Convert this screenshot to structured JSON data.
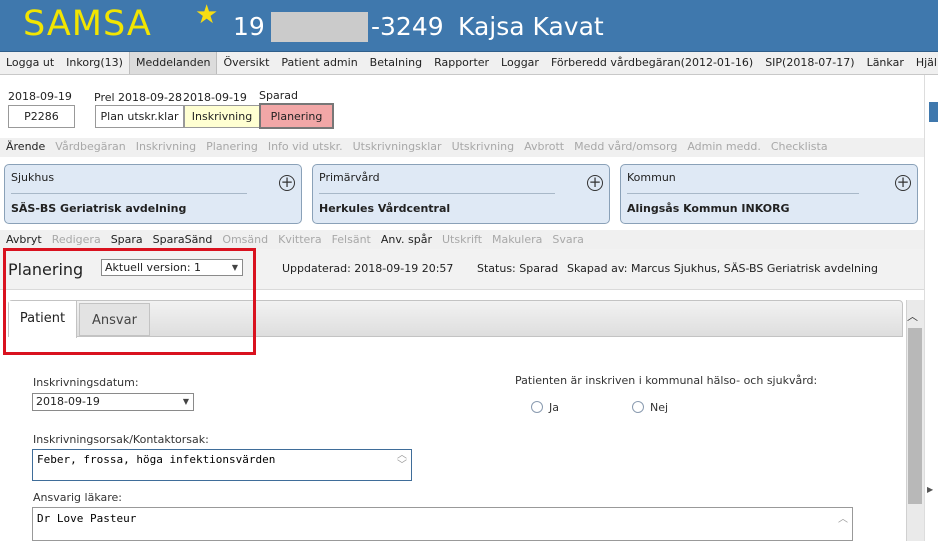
{
  "header": {
    "logo": "SAMSA",
    "patient_prefix": "19",
    "patient_suffix": "-3249",
    "patient_name": "Kajsa Kavat"
  },
  "menu": [
    "Logga ut",
    "Inkorg(13)",
    "Meddelanden",
    "Översikt",
    "Patient admin",
    "Betalning",
    "Rapporter",
    "Loggar",
    "Förberedd vårdbegäran(2012-01-16)",
    "SIP(2018-07-17)",
    "Länkar",
    "Hjälp"
  ],
  "menu_active": "Meddelanden",
  "info": {
    "date1": "2018-09-19",
    "id": "P2286",
    "prel_label": "Prel 2018-09-28",
    "date2": "2018-09-19",
    "sparad": "Sparad",
    "btn_plan": "Plan utskr.klar",
    "btn_inskrivning": "Inskrivning",
    "btn_planering": "Planering"
  },
  "steps": [
    {
      "label": "Ärende",
      "on": true
    },
    {
      "label": "Vårdbegäran",
      "on": false
    },
    {
      "label": "Inskrivning",
      "on": false
    },
    {
      "label": "Planering",
      "on": false
    },
    {
      "label": "Info vid utskr.",
      "on": false
    },
    {
      "label": "Utskrivningsklar",
      "on": false
    },
    {
      "label": "Utskrivning",
      "on": false
    },
    {
      "label": "Avbrott",
      "on": false
    },
    {
      "label": "Medd vård/omsorg",
      "on": false
    },
    {
      "label": "Admin medd.",
      "on": false
    },
    {
      "label": "Checklista",
      "on": false
    }
  ],
  "cards": [
    {
      "title": "Sjukhus",
      "value": "SÄS-BS Geriatrisk avdelning"
    },
    {
      "title": "Primärvård",
      "value": "Herkules Vårdcentral"
    },
    {
      "title": "Kommun",
      "value": "Alingsås Kommun INKORG"
    }
  ],
  "actions": [
    {
      "label": "Avbryt",
      "on": true
    },
    {
      "label": "Redigera",
      "on": false
    },
    {
      "label": "Spara",
      "on": true
    },
    {
      "label": "SparaSänd",
      "on": true
    },
    {
      "label": "Omsänd",
      "on": false
    },
    {
      "label": "Kvittera",
      "on": false
    },
    {
      "label": "Felsänt",
      "on": false
    },
    {
      "label": "Anv. spår",
      "on": true
    },
    {
      "label": "Utskrift",
      "on": false
    },
    {
      "label": "Makulera",
      "on": false
    },
    {
      "label": "Svara",
      "on": false
    }
  ],
  "plan": {
    "title": "Planering",
    "version": "Aktuell version: 1",
    "updated": "Uppdaterad: 2018-09-19 20:57",
    "status": "Status: Sparad",
    "created": "Skapad av: Marcus Sjukhus, SÄS-BS Geriatrisk avdelning"
  },
  "tabs": {
    "patient": "Patient",
    "ansvar": "Ansvar"
  },
  "form": {
    "inskr_label": "Inskrivningsdatum:",
    "inskr_value": "2018-09-19",
    "kommunal_label": "Patienten är inskriven i kommunal hälso- och sjukvård:",
    "ja": "Ja",
    "nej": "Nej",
    "orsak_label": "Inskrivningsorsak/Kontaktorsak:",
    "orsak_value": "Feber, frossa, höga infektionsvärden",
    "lakare_label": "Ansvarig läkare:",
    "lakare_value": "Dr Love Pasteur"
  },
  "colors": {
    "header": "#3f78ad",
    "logo": "#f2e500",
    "inskrivning_bg": "#ffffd2",
    "planering_bg": "#f2a7a7",
    "card_bg": "#dfe9f5",
    "highlight": "#d9121f"
  }
}
